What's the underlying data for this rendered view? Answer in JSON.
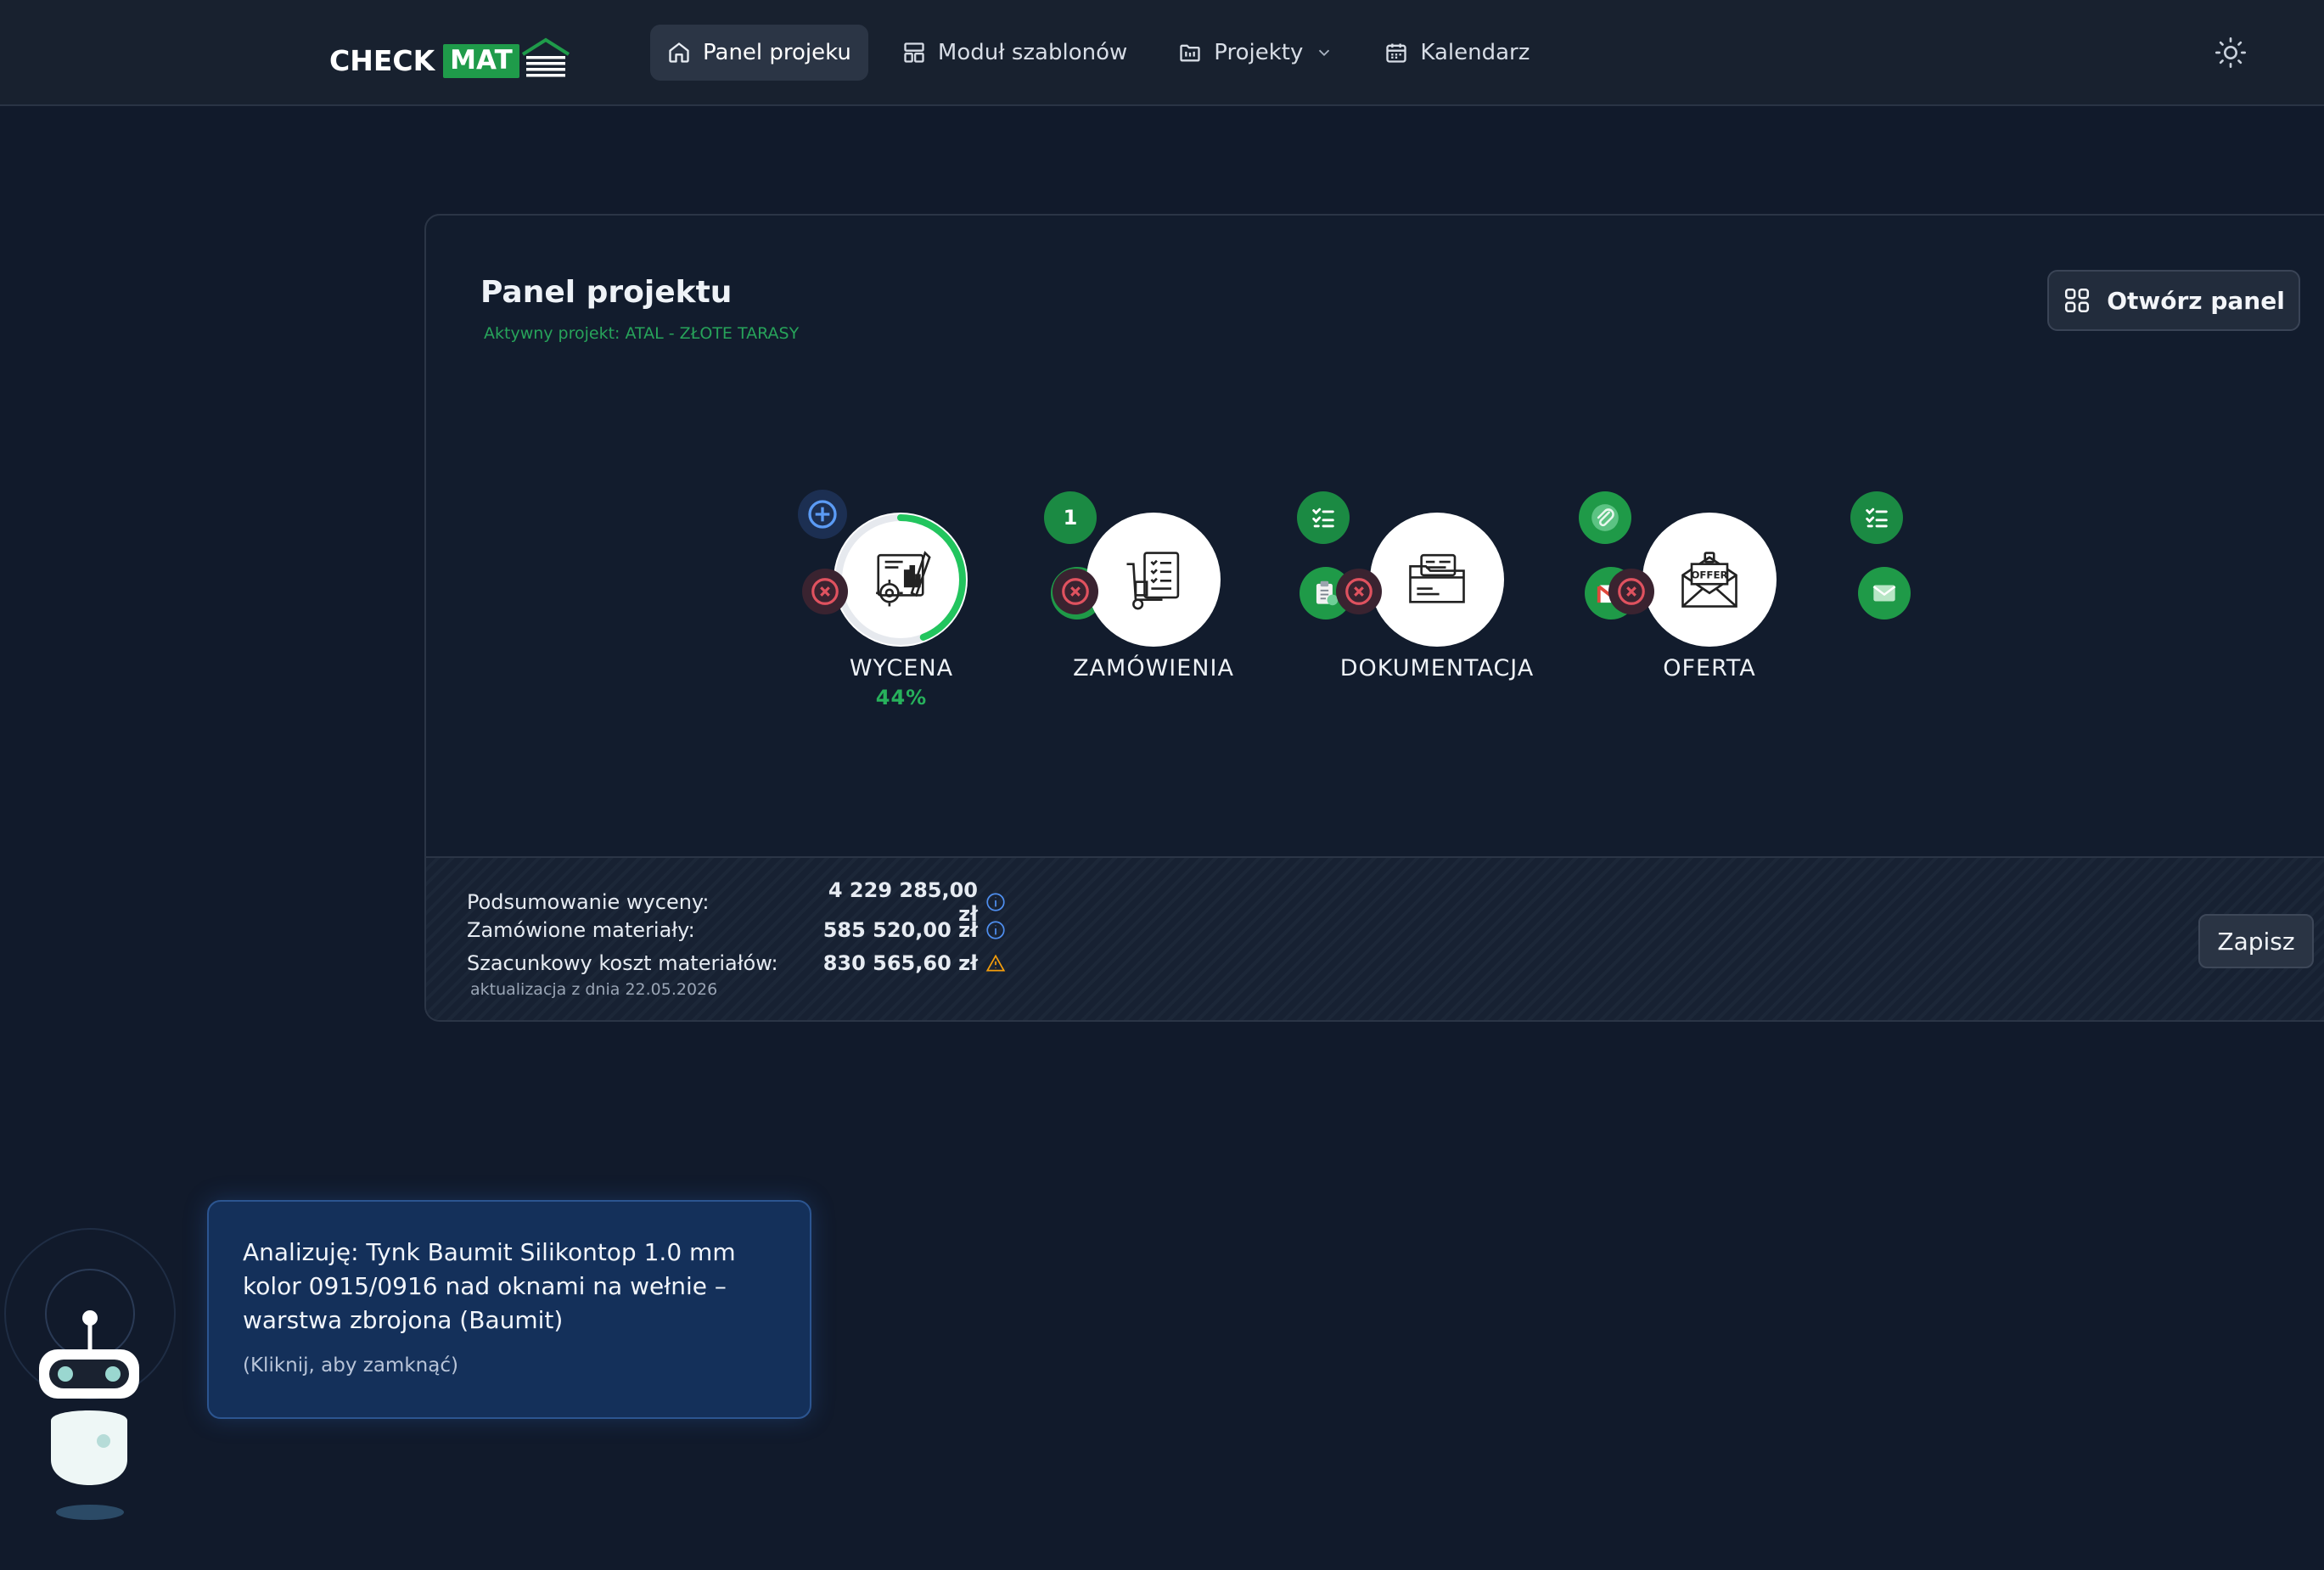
{
  "header": {
    "logo_check": "CHECK",
    "logo_mat": "MAT",
    "nav": [
      {
        "label": "Panel projeku",
        "icon": "home-icon",
        "active": true
      },
      {
        "label": "Moduł szablonów",
        "icon": "layout-icon"
      },
      {
        "label": "Projekty",
        "icon": "folder-icon"
      },
      {
        "label": "Kalendarz",
        "icon": "calendar-icon"
      }
    ],
    "theme_icon": "sun-icon"
  },
  "panel": {
    "title": "Panel projektu",
    "active_project": "Aktywny projekt: ATAL - ZŁOTE TARASY",
    "open_button": "Otwórz panel"
  },
  "stages": [
    {
      "label": "WYCENA",
      "progress_text": "44%",
      "progress": 0.44,
      "badge_count": "1"
    },
    {
      "label": "ZAMÓWIENIA"
    },
    {
      "label": "DOKUMENTACJA"
    },
    {
      "label": "OFERTA",
      "icon_text": "OFFER"
    }
  ],
  "summary": {
    "rows": [
      {
        "label": "Podsumowanie wyceny:",
        "value": "4 229 285,00 zł",
        "icon": "info-icon"
      },
      {
        "label": "Zamówione materiały:",
        "value": "585 520,00 zł",
        "icon": "info-icon"
      },
      {
        "label": "Szacunkowy koszt materiałów:",
        "value": "830 565,60 zł",
        "icon": "warning-icon"
      }
    ],
    "note": "aktualizacja z dnia 22.05.2026",
    "save_button": "Zapisz"
  },
  "assistant": {
    "message": "Analizuję: Tynk Baumit Silikontop 1.0 mm kolor 0915/0916 nad oknami na wełnie – warstwa zbrojona (Baumit)",
    "hint": "(Kliknij, aby zamknąć)"
  },
  "colors": {
    "accent_green": "#1f9b4a",
    "background": "#111a2b",
    "danger": "#e0525f",
    "info": "#3b82f6",
    "warning": "#f59e0b"
  }
}
